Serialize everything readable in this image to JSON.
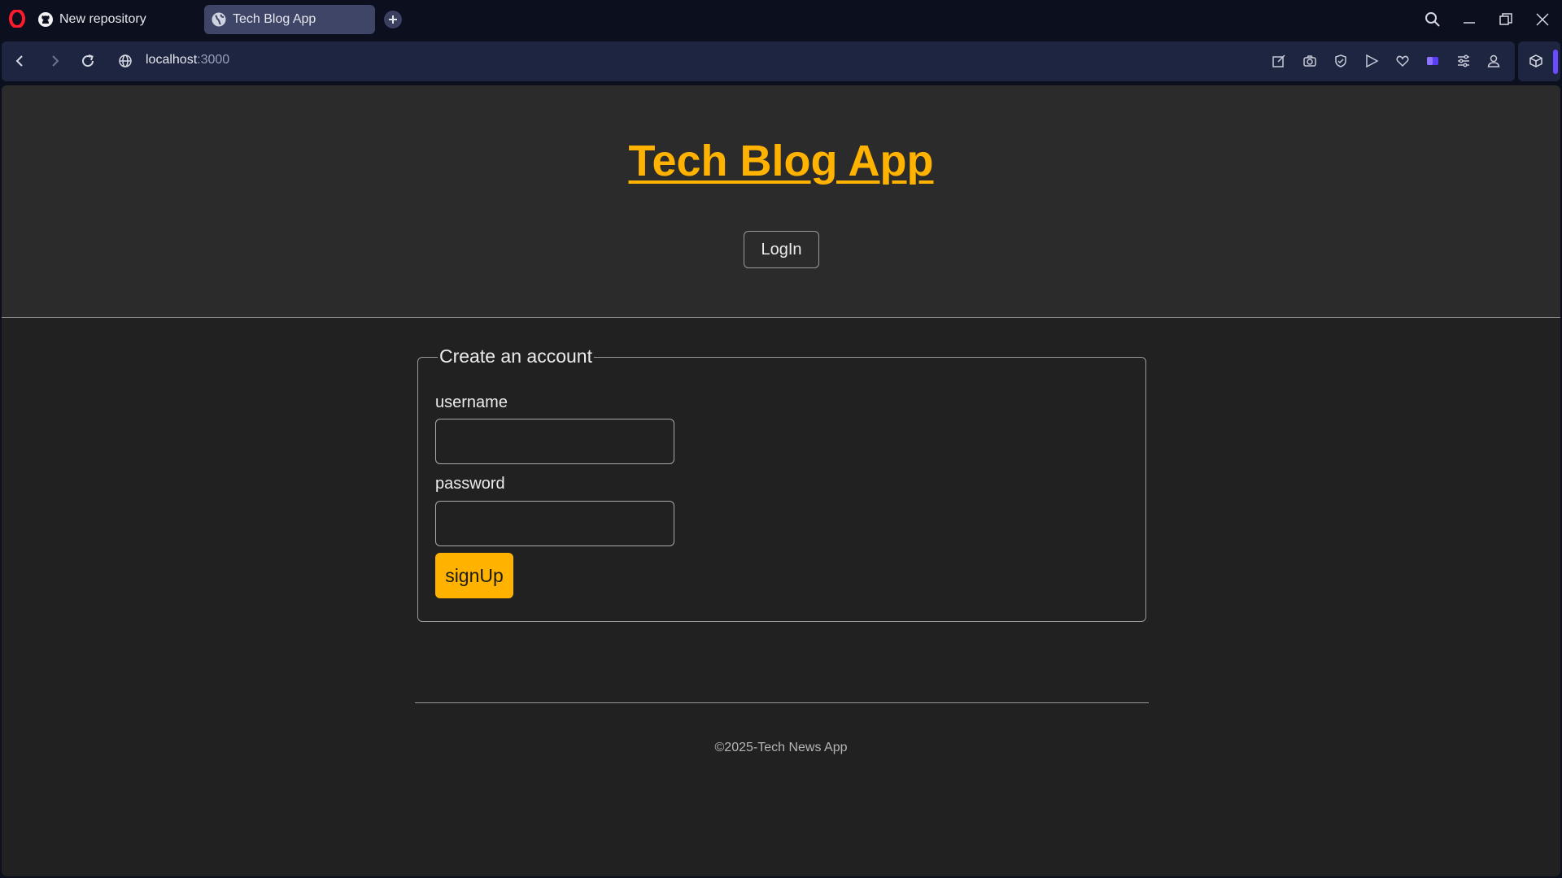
{
  "browser": {
    "tabs": [
      {
        "title": "New repository",
        "icon": "github-icon"
      },
      {
        "title": "Tech Blog App",
        "icon": "globe-icon",
        "active": true
      }
    ],
    "url": {
      "host": "localhost",
      "port": ":3000"
    },
    "toolbar_icons": [
      "edit-icon",
      "camera-icon",
      "shield-icon",
      "send-icon",
      "heart-icon",
      "wallet-icon",
      "easy-setup-icon",
      "profile-icon",
      "extensions-icon"
    ],
    "colors": {
      "chrome": "#0b0f1e",
      "address_bar": "#1e2540",
      "active_tab": "#3f4566"
    }
  },
  "header": {
    "title": "Tech Blog App",
    "login_label": "LogIn"
  },
  "signup_form": {
    "legend": "Create an account",
    "username_label": "username",
    "username_value": "",
    "password_label": "password",
    "password_value": "",
    "submit_label": "signUp"
  },
  "footer": {
    "text": "©2025-Tech News App"
  },
  "theme": {
    "accent": "#ffb300",
    "page_bg": "#212121",
    "header_bg": "#2b2b2b"
  }
}
